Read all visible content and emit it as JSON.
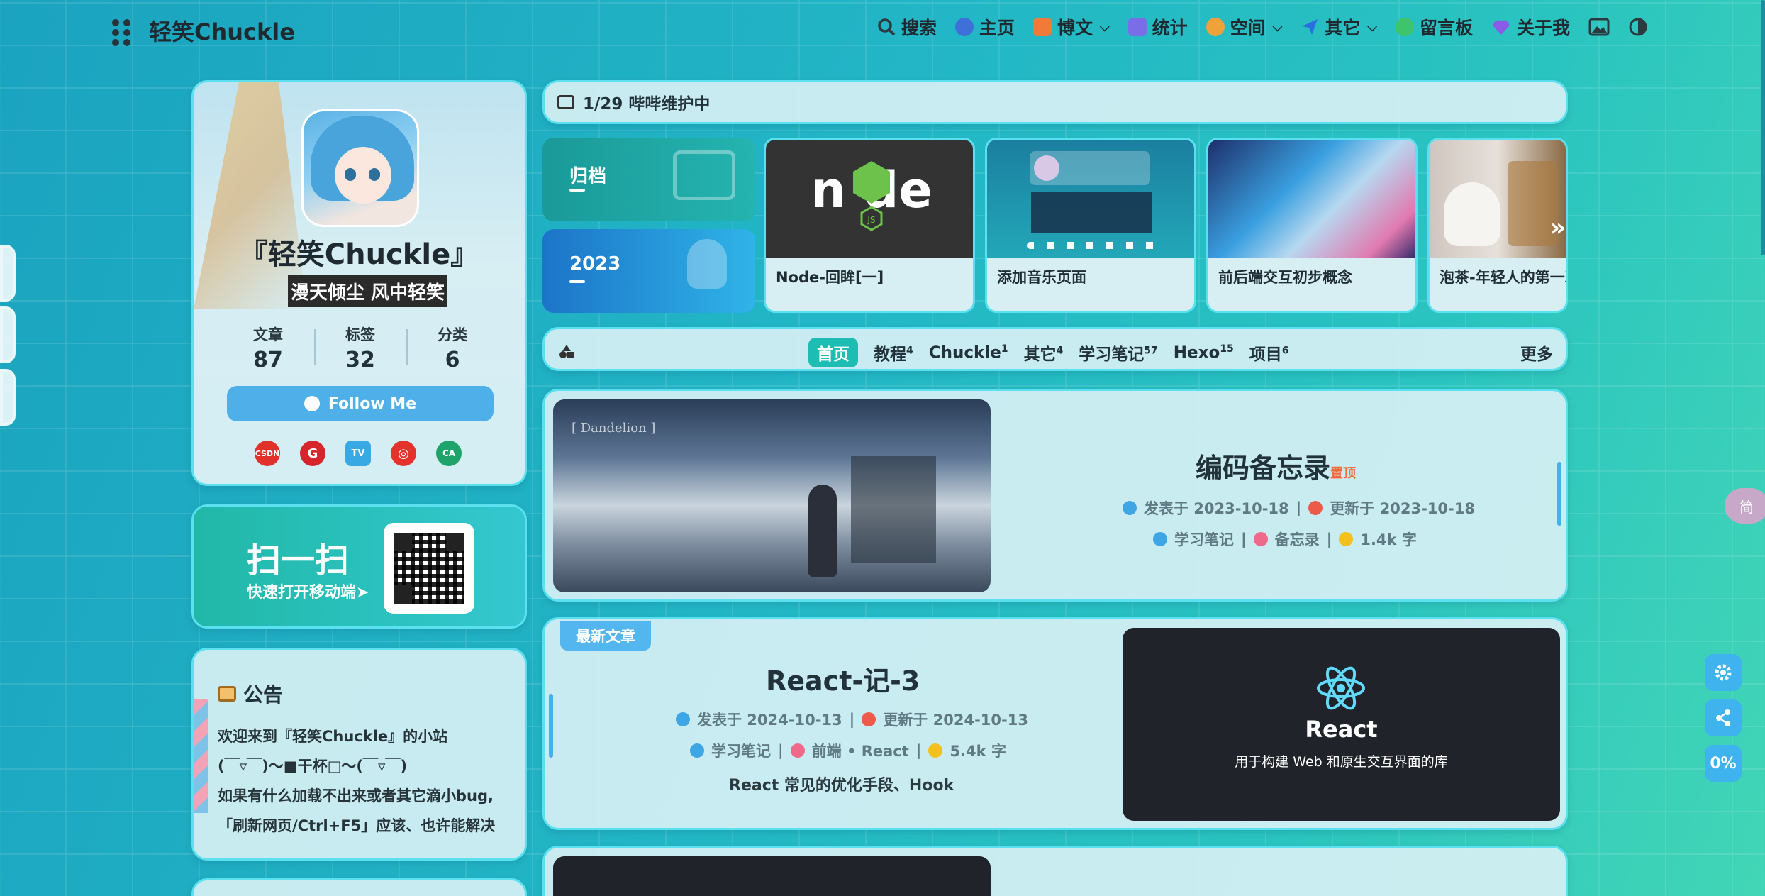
{
  "nav": {
    "brand": "轻笑Chuckle",
    "items": [
      {
        "label": "搜索",
        "icon": "search-icon",
        "color": "#2c3a40",
        "chevron": false
      },
      {
        "label": "主页",
        "icon": "home-icon",
        "color": "#3f6fd8",
        "chevron": false
      },
      {
        "label": "博文",
        "icon": "article-icon",
        "color": "#f07a3a",
        "chevron": true
      },
      {
        "label": "统计",
        "icon": "stats-icon",
        "color": "#7a6ee8",
        "chevron": false
      },
      {
        "label": "空间",
        "icon": "space-icon",
        "color": "#f0a23a",
        "chevron": true
      },
      {
        "label": "其它",
        "icon": "plane-icon",
        "color": "#2a6fe0",
        "chevron": true
      },
      {
        "label": "留言板",
        "icon": "message-icon",
        "color": "#3ec46a",
        "chevron": false
      },
      {
        "label": "关于我",
        "icon": "heart-icon",
        "color": "#8a5ae8",
        "chevron": false
      }
    ]
  },
  "profile": {
    "name": "『轻笑Chuckle』",
    "motto": "漫天倾尘 风中轻笑",
    "stats": [
      {
        "label": "文章",
        "value": "87"
      },
      {
        "label": "标签",
        "value": "32"
      },
      {
        "label": "分类",
        "value": "6"
      }
    ],
    "follow_label": "Follow Me",
    "socials": [
      {
        "name": "csdn-icon",
        "text": "CSDN",
        "color": "#e0322a"
      },
      {
        "name": "gitee-icon",
        "text": "G",
        "color": "#d6262b"
      },
      {
        "name": "bilibili-icon",
        "text": "TV",
        "color": "#39a9e3"
      },
      {
        "name": "netease-music-icon",
        "text": "◎",
        "color": "#e2332c"
      },
      {
        "name": "cloud-icon",
        "text": "CA",
        "color": "#1ea46a"
      }
    ]
  },
  "scan": {
    "title": "扫一扫",
    "subtitle": "快速打开移动端➤"
  },
  "notice": {
    "title": "公告",
    "lines": [
      "欢迎来到『轻笑Chuckle』的小站",
      "(￣▿￣)～■干杯□～(￣▿￣)",
      "如果有什么加载不出来或者其它滴小bug,",
      "「刷新网页/Ctrl+F5」应该、也许能解决"
    ]
  },
  "announcement": "1/29 哔哔维护中",
  "categories": [
    {
      "label": "归档"
    },
    {
      "label": "2023"
    }
  ],
  "recent_posts": [
    {
      "title": "Node-回眸[一]"
    },
    {
      "title": "添加音乐页面"
    },
    {
      "title": "前后端交互初步概念"
    },
    {
      "title": "泡茶-年轻人的第一次"
    }
  ],
  "category_nav": {
    "items": [
      {
        "label": "首页",
        "count": "",
        "active": true
      },
      {
        "label": "教程",
        "count": "4",
        "active": false
      },
      {
        "label": "Chuckle",
        "count": "1",
        "active": false
      },
      {
        "label": "其它",
        "count": "4",
        "active": false
      },
      {
        "label": "学习笔记",
        "count": "57",
        "active": false
      },
      {
        "label": "Hexo",
        "count": "15",
        "active": false
      },
      {
        "label": "项目",
        "count": "6",
        "active": false
      }
    ],
    "more": "更多"
  },
  "articles": [
    {
      "title": "编码备忘录",
      "pin": "置顶",
      "published": "发表于 2023-10-18",
      "updated": "更新于 2023-10-18",
      "category": "学习笔记",
      "tags": "备忘录",
      "words": "1.4k 字",
      "image_caption": "[ Dandelion ]"
    },
    {
      "badge": "最新文章",
      "title": "React-记-3",
      "published": "发表于 2024-10-13",
      "updated": "更新于 2024-10-13",
      "category": "学习笔记",
      "tags": "前端 • React",
      "words": "5.4k 字",
      "description": "React 常见的优化手段、Hook",
      "image_title": "React",
      "image_subtitle": "用于构建 Web 和原生交互界面的库"
    }
  ],
  "float": {
    "progress": "0%",
    "translate": "简"
  },
  "colors": {
    "accent": "#1ebdb4",
    "border": "#5ae0ef",
    "follow": "#4fb0e9"
  }
}
